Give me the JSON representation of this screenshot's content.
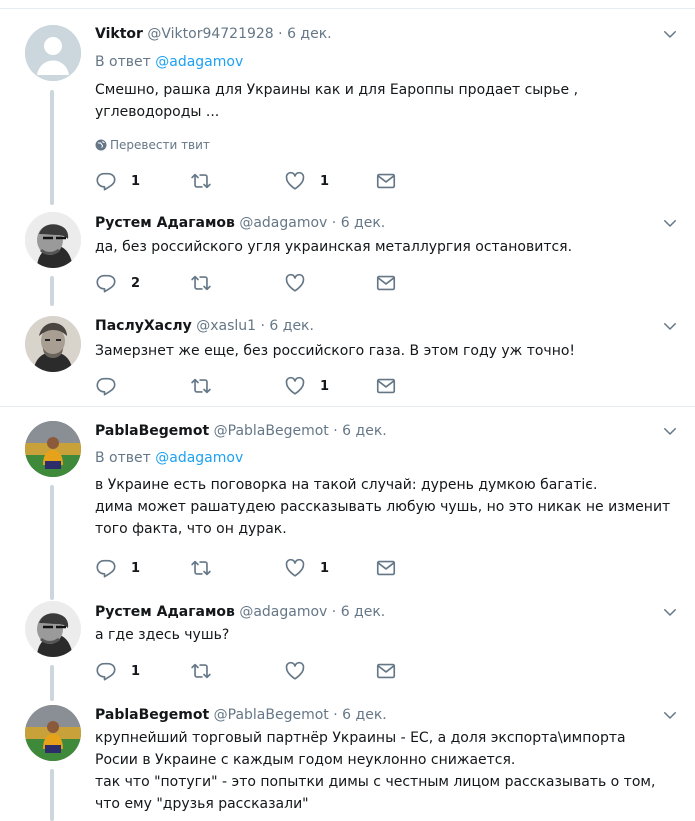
{
  "tweets": [
    {
      "name": "Viktor",
      "handle": "@Viktor94721928",
      "dot": "·",
      "date": "6 дек.",
      "reply_prefix": "В ответ",
      "reply_user": "@adagamov",
      "lines": [
        "Смешно, рашка для Украины как и для Еароппы продает сырье ,",
        "углеводороды ..."
      ],
      "translate": "Перевести твит",
      "reply_count": "1",
      "retweet_count": "",
      "like_count": "1"
    },
    {
      "name": "Рустем Адагамов",
      "handle": "@adagamov",
      "dot": "·",
      "date": "6 дек.",
      "lines": [
        "да, без российского угля украинская металлургия остановится."
      ],
      "reply_count": "2",
      "retweet_count": "",
      "like_count": ""
    },
    {
      "name": "ПаслуХаслу",
      "handle": "@xaslu1",
      "dot": "·",
      "date": "6 дек.",
      "lines": [
        "Замерзнет же еще,  без российского газа. В этом году уж точно!"
      ],
      "reply_count": "",
      "retweet_count": "",
      "like_count": "1"
    },
    {
      "name": "PablaBegemot",
      "handle": "@PablaBegemot",
      "dot": "·",
      "date": "6 дек.",
      "reply_prefix": "В ответ",
      "reply_user": "@adagamov",
      "lines": [
        "в Украине есть поговорка на такой случай: дурень думкою багатіє.",
        "дима может рашатудею рассказывать любую чушь, но это никак не изменит",
        "того факта, что он дурак."
      ],
      "reply_count": "1",
      "retweet_count": "",
      "like_count": "1"
    },
    {
      "name": "Рустем Адагамов",
      "handle": "@adagamov",
      "dot": "·",
      "date": "6 дек.",
      "lines": [
        "а где здесь чушь?"
      ],
      "reply_count": "1",
      "retweet_count": "",
      "like_count": ""
    },
    {
      "name": "PablaBegemot",
      "handle": "@PablaBegemot",
      "dot": "·",
      "date": "6 дек.",
      "lines": [
        "крупнейший торговый партнёр Украины - ЕС, а доля экспорта\\импорта",
        "Росии в Украине с каждым годом неуклонно снижается.",
        "так что \"потуги\" - это попытки димы с честным лицом рассказывать о том,",
        "что ему \"друзья рассказали\""
      ]
    }
  ],
  "colors": {
    "link": "#1da1f2",
    "muted": "#657786",
    "text": "#14171a",
    "thread": "#ccd6dd",
    "border": "#e6ecf0"
  },
  "icons": [
    "reply-icon",
    "retweet-icon",
    "like-icon",
    "direct-message-icon",
    "chevron-down-icon",
    "globe-icon"
  ]
}
